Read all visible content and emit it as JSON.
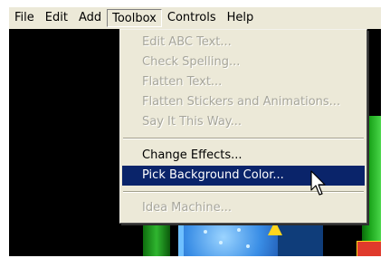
{
  "menubar": {
    "items": [
      {
        "label": "File"
      },
      {
        "label": "Edit"
      },
      {
        "label": "Add"
      },
      {
        "label": "Toolbox"
      },
      {
        "label": "Controls"
      },
      {
        "label": "Help"
      }
    ],
    "active": "Toolbox"
  },
  "toolbox_menu": {
    "items": [
      {
        "label": "Edit ABC Text...",
        "enabled": false
      },
      {
        "label": "Check Spelling...",
        "enabled": false
      },
      {
        "label": "Flatten Text...",
        "enabled": false
      },
      {
        "label": "Flatten Stickers and Animations...",
        "enabled": false
      },
      {
        "label": "Say It This Way...",
        "enabled": false
      },
      {
        "label": "Change Effects...",
        "enabled": true
      },
      {
        "label": "Pick Background Color...",
        "enabled": true,
        "highlighted": true
      },
      {
        "label": "Idea Machine...",
        "enabled": false
      }
    ]
  },
  "colors": {
    "menu_bg": "#ece9d8",
    "highlight": "#0a246a",
    "disabled_text": "#a7a69b"
  },
  "cursor": {
    "icon": "arrow-cursor-icon"
  }
}
